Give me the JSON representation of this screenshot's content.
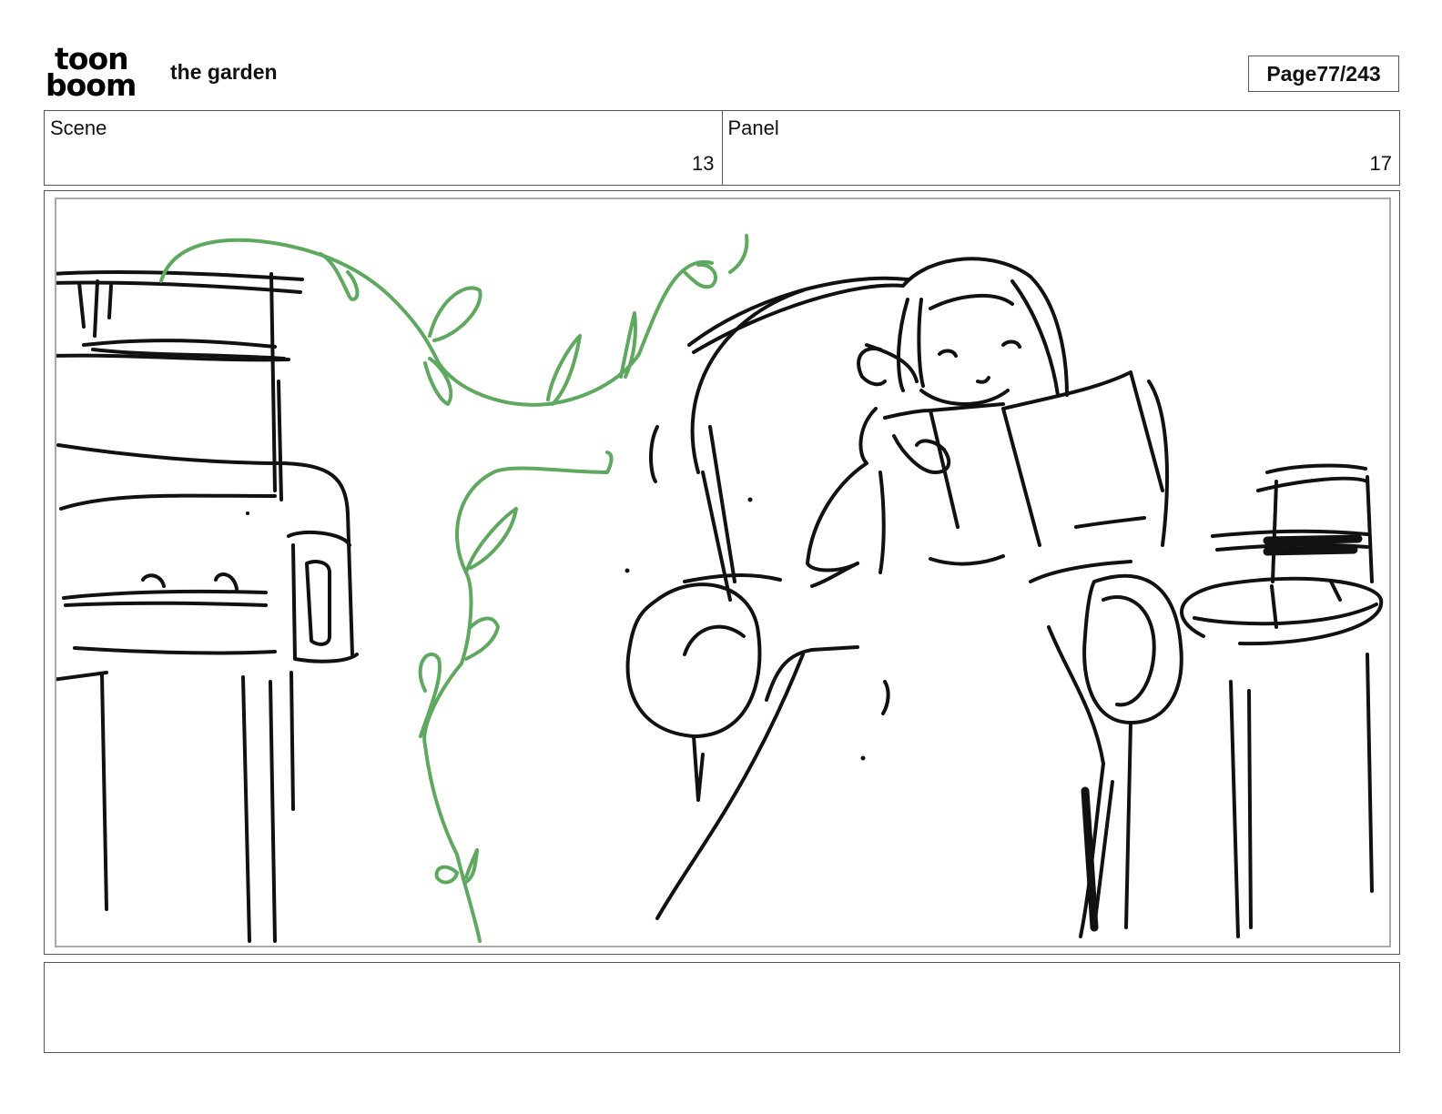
{
  "header": {
    "logo_line1": "toon",
    "logo_line2": "boom",
    "project_title": "the garden",
    "page_label": "Page",
    "page_number": "77/243"
  },
  "info": {
    "scene_label": "Scene",
    "scene_value": "13",
    "panel_label": "Panel",
    "panel_value": "17"
  },
  "colors": {
    "sketch_ink": "#111111",
    "vine_green": "#5fa85f",
    "border": "#555555"
  },
  "notes": ""
}
